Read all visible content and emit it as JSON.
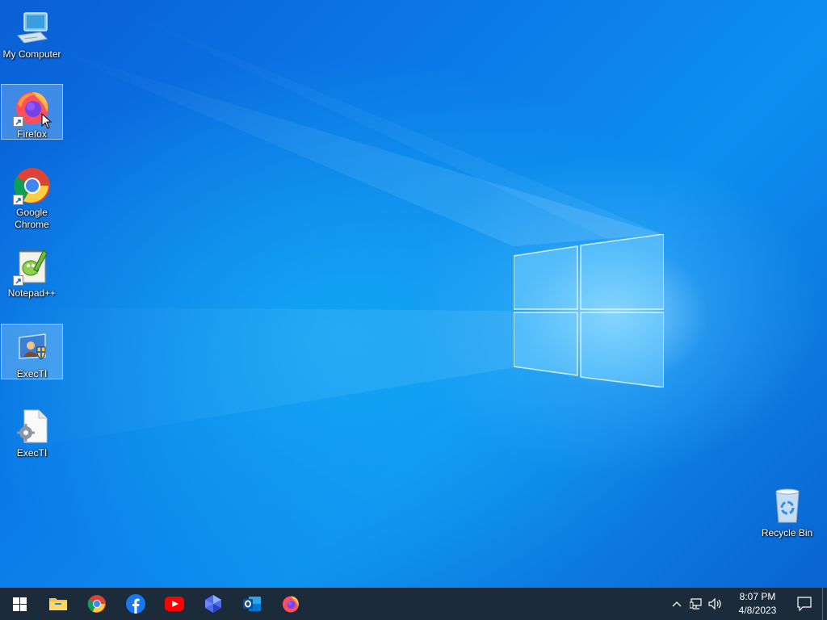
{
  "desktop": {
    "icons": [
      {
        "label": "My Computer",
        "icon": "computer-icon"
      },
      {
        "label": "Firefox",
        "icon": "firefox-icon"
      },
      {
        "label": "Google Chrome",
        "icon": "chrome-icon"
      },
      {
        "label": "Notepad++",
        "icon": "notepadpp-icon"
      },
      {
        "label": "ExecTI",
        "icon": "execti-shortcut-icon"
      },
      {
        "label": "ExecTI",
        "icon": "execti-file-icon"
      },
      {
        "label": "Recycle Bin",
        "icon": "recycle-bin-icon"
      }
    ]
  },
  "taskbar": {
    "pinned": [
      {
        "name": "start",
        "icon": "windows-start-icon"
      },
      {
        "name": "file-explorer",
        "icon": "folder-icon"
      },
      {
        "name": "chrome",
        "icon": "chrome-icon"
      },
      {
        "name": "facebook",
        "icon": "facebook-icon"
      },
      {
        "name": "youtube",
        "icon": "youtube-icon"
      },
      {
        "name": "power-automate",
        "icon": "power-automate-icon"
      },
      {
        "name": "outlook",
        "icon": "outlook-icon"
      },
      {
        "name": "firefox",
        "icon": "firefox-icon"
      }
    ],
    "clock": {
      "time": "8:07 PM",
      "date": "4/8/2023"
    }
  },
  "colors": {
    "taskbar_bg": "#1c2b3a",
    "desktop_accent": "#0b7ae6"
  }
}
